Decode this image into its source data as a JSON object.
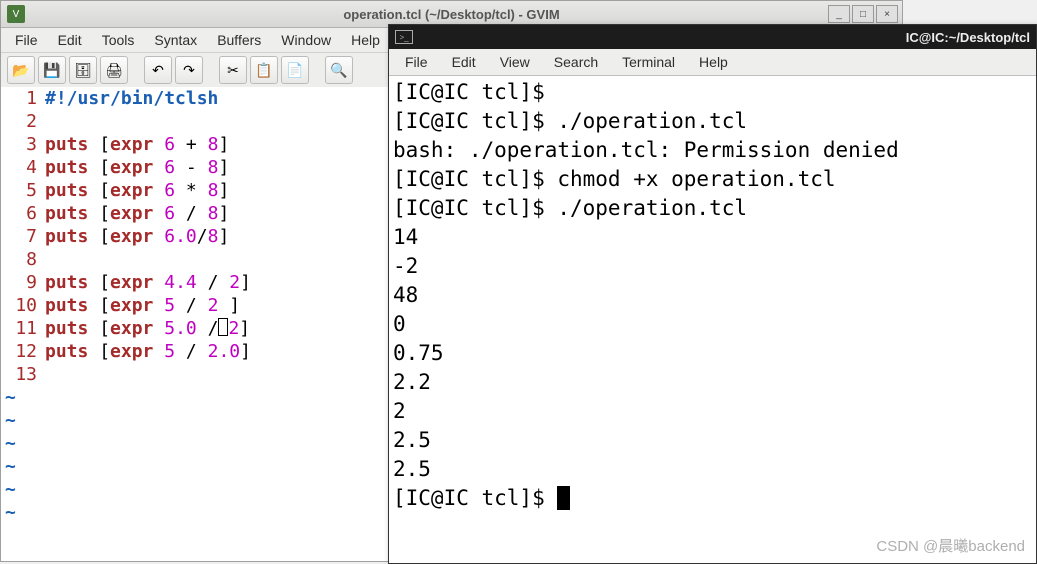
{
  "watermark": "CSDN @晨曦backend",
  "gvim": {
    "title": "operation.tcl (~/Desktop/tcl) - GVIM",
    "app_icon_label": "V",
    "win_btns": {
      "min": "_",
      "max": "□",
      "close": "×"
    },
    "menu": [
      "File",
      "Edit",
      "Tools",
      "Syntax",
      "Buffers",
      "Window",
      "Help"
    ],
    "toolbar_icons": [
      "open-icon",
      "save-icon",
      "saveall-icon",
      "print-icon",
      "sep",
      "undo-icon",
      "redo-icon",
      "sep",
      "cut-icon",
      "copy-icon",
      "paste-icon",
      "sep",
      "find-icon"
    ],
    "code": [
      {
        "n": "1",
        "tokens": [
          {
            "c": "sh",
            "t": "#!/usr/bin/tclsh"
          }
        ]
      },
      {
        "n": "2",
        "tokens": []
      },
      {
        "n": "3",
        "tokens": [
          {
            "c": "kw",
            "t": "puts"
          },
          {
            "c": "op",
            "t": " ["
          },
          {
            "c": "kw",
            "t": "expr"
          },
          {
            "c": "op",
            "t": " "
          },
          {
            "c": "num",
            "t": "6"
          },
          {
            "c": "op",
            "t": " + "
          },
          {
            "c": "num",
            "t": "8"
          },
          {
            "c": "op",
            "t": "]"
          }
        ]
      },
      {
        "n": "4",
        "tokens": [
          {
            "c": "kw",
            "t": "puts"
          },
          {
            "c": "op",
            "t": " ["
          },
          {
            "c": "kw",
            "t": "expr"
          },
          {
            "c": "op",
            "t": " "
          },
          {
            "c": "num",
            "t": "6"
          },
          {
            "c": "op",
            "t": " - "
          },
          {
            "c": "num",
            "t": "8"
          },
          {
            "c": "op",
            "t": "]"
          }
        ]
      },
      {
        "n": "5",
        "tokens": [
          {
            "c": "kw",
            "t": "puts"
          },
          {
            "c": "op",
            "t": " ["
          },
          {
            "c": "kw",
            "t": "expr"
          },
          {
            "c": "op",
            "t": " "
          },
          {
            "c": "num",
            "t": "6"
          },
          {
            "c": "op",
            "t": " * "
          },
          {
            "c": "num",
            "t": "8"
          },
          {
            "c": "op",
            "t": "]"
          }
        ]
      },
      {
        "n": "6",
        "tokens": [
          {
            "c": "kw",
            "t": "puts"
          },
          {
            "c": "op",
            "t": " ["
          },
          {
            "c": "kw",
            "t": "expr"
          },
          {
            "c": "op",
            "t": " "
          },
          {
            "c": "num",
            "t": "6"
          },
          {
            "c": "op",
            "t": " / "
          },
          {
            "c": "num",
            "t": "8"
          },
          {
            "c": "op",
            "t": "]"
          }
        ]
      },
      {
        "n": "7",
        "tokens": [
          {
            "c": "kw",
            "t": "puts"
          },
          {
            "c": "op",
            "t": " ["
          },
          {
            "c": "kw",
            "t": "expr"
          },
          {
            "c": "op",
            "t": " "
          },
          {
            "c": "num",
            "t": "6.0"
          },
          {
            "c": "op",
            "t": "/"
          },
          {
            "c": "num",
            "t": "8"
          },
          {
            "c": "op",
            "t": "]"
          }
        ]
      },
      {
        "n": "8",
        "tokens": []
      },
      {
        "n": "9",
        "tokens": [
          {
            "c": "kw",
            "t": "puts"
          },
          {
            "c": "op",
            "t": " ["
          },
          {
            "c": "kw",
            "t": "expr"
          },
          {
            "c": "op",
            "t": " "
          },
          {
            "c": "num",
            "t": "4.4"
          },
          {
            "c": "op",
            "t": " / "
          },
          {
            "c": "num",
            "t": "2"
          },
          {
            "c": "op",
            "t": "]"
          }
        ]
      },
      {
        "n": "10",
        "tokens": [
          {
            "c": "kw",
            "t": "puts"
          },
          {
            "c": "op",
            "t": " ["
          },
          {
            "c": "kw",
            "t": "expr"
          },
          {
            "c": "op",
            "t": " "
          },
          {
            "c": "num",
            "t": "5"
          },
          {
            "c": "op",
            "t": " / "
          },
          {
            "c": "num",
            "t": "2"
          },
          {
            "c": "op",
            "t": " ]"
          }
        ]
      },
      {
        "n": "11",
        "tokens": [
          {
            "c": "kw",
            "t": "puts"
          },
          {
            "c": "op",
            "t": " ["
          },
          {
            "c": "kw",
            "t": "expr"
          },
          {
            "c": "op",
            "t": " "
          },
          {
            "c": "num",
            "t": "5.0"
          },
          {
            "c": "op",
            "t": " /"
          },
          {
            "c": "cursor",
            "t": ""
          },
          {
            "c": "num",
            "t": "2"
          },
          {
            "c": "op",
            "t": "]"
          }
        ]
      },
      {
        "n": "12",
        "tokens": [
          {
            "c": "kw",
            "t": "puts"
          },
          {
            "c": "op",
            "t": " ["
          },
          {
            "c": "kw",
            "t": "expr"
          },
          {
            "c": "op",
            "t": " "
          },
          {
            "c": "num",
            "t": "5"
          },
          {
            "c": "op",
            "t": " / "
          },
          {
            "c": "num",
            "t": "2.0"
          },
          {
            "c": "op",
            "t": "]"
          }
        ]
      },
      {
        "n": "13",
        "tokens": []
      }
    ],
    "tildes": 6
  },
  "terminal": {
    "title": "IC@IC:~/Desktop/tcl",
    "icon_label": ">_",
    "menu": [
      "File",
      "Edit",
      "View",
      "Search",
      "Terminal",
      "Help"
    ],
    "lines": [
      "[IC@IC tcl]$ ",
      "[IC@IC tcl]$ ./operation.tcl",
      "bash: ./operation.tcl: Permission denied",
      "[IC@IC tcl]$ chmod +x operation.tcl",
      "[IC@IC tcl]$ ./operation.tcl",
      "14",
      "-2",
      "48",
      "0",
      "0.75",
      "2.2",
      "2",
      "2.5",
      "2.5",
      "[IC@IC tcl]$ "
    ]
  }
}
